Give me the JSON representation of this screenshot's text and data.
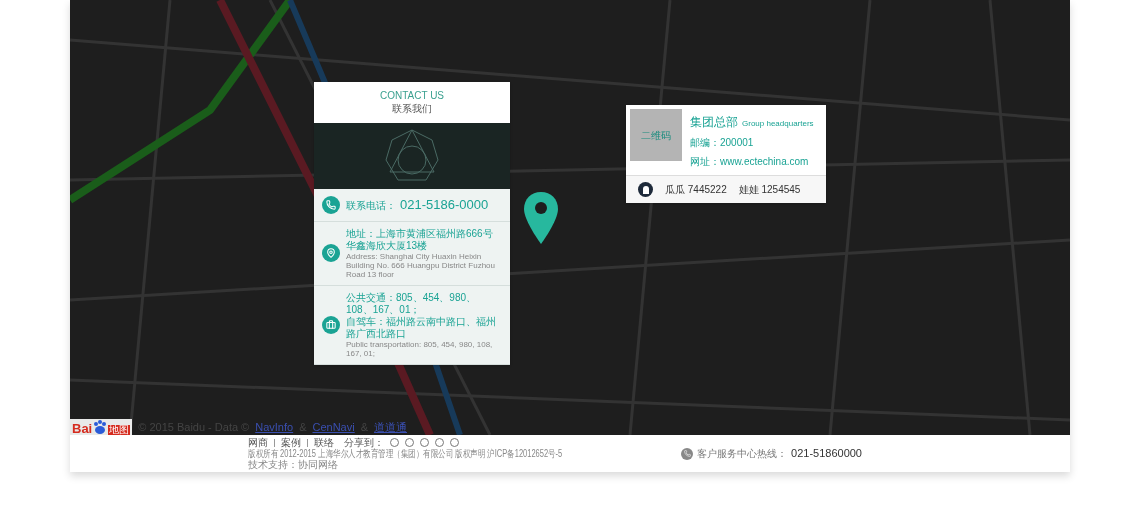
{
  "map": {
    "attribution": {
      "logo_left": "Bai",
      "logo_right": "地图",
      "text": "© 2015 Baidu - Data ©",
      "links": [
        {
          "label": "NavInfo"
        },
        {
          "label": "CenNavi"
        },
        {
          "label": "道道通"
        }
      ],
      "separator": "&"
    }
  },
  "contact_card": {
    "title_en": "CONTACT US",
    "title_zh": "联系我们",
    "rows": [
      {
        "kind": "phone",
        "label": "联系电话：",
        "value": "021-5186-0000"
      },
      {
        "kind": "address",
        "lines": [
          "地址：上海市黄浦区福州路666号华鑫海欣大厦13楼"
        ],
        "sub": "Address: Shanghai City Huaxin Heixin Building No. 666 Huangpu District Fuzhou Road 13 floor"
      },
      {
        "kind": "transit",
        "lines": [
          "公共交通：805、454、980、108、167、01；",
          "自驾车：福州路云南中路口、福州路广西北路口"
        ],
        "sub": "Public transportation: 805, 454, 980, 108, 167, 01;"
      }
    ]
  },
  "hq_card": {
    "qr_label": "二维码",
    "title": "集团总部",
    "title_en": "Group headquarters",
    "fields": [
      {
        "label": "邮编：",
        "value": "200001"
      },
      {
        "label": "网址：",
        "value": "www.ectechina.com"
      }
    ],
    "contacts": [
      {
        "name": "瓜瓜",
        "number": "7445222"
      },
      {
        "name": "娃娃",
        "number": "1254545"
      }
    ]
  },
  "footer": {
    "links": [
      {
        "label": "网商"
      },
      {
        "label": "案例"
      },
      {
        "label": "联络"
      }
    ],
    "share_label": "分享到：",
    "copyright": "版权所有 2012-2015 上海华尔人才教育管理（集团）有限公司 版权声明 沪ICP备12012652号-5",
    "support": "技术支持：协同网络",
    "hotline_label": "客户服务中心热线：",
    "hotline": "021-51860000"
  }
}
